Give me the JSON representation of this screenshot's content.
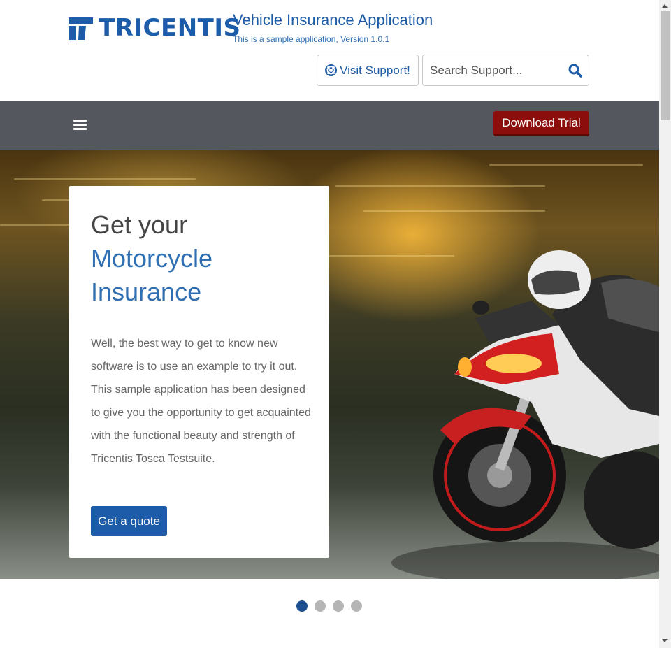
{
  "header": {
    "logo_text": "TRICENTIS",
    "app_title": "Vehicle Insurance Application",
    "app_subtitle": "This is a sample application, Version 1.0.1",
    "support_button": "Visit Support!",
    "search_placeholder": "Search Support..."
  },
  "navbar": {
    "download_trial": "Download Trial"
  },
  "hero": {
    "title_line1": "Get your",
    "title_line2": "Motorcycle",
    "title_line3": "Insurance",
    "body": "Well, the best way to get to know new software is to use an example to try it out. This sample application has been designed to give you the opportunity to get acquainted with the functional beauty and strength of Tricentis Tosca Testsuite.",
    "cta": "Get a quote"
  },
  "carousel": {
    "slides": 4,
    "active_index": 0
  },
  "colors": {
    "brand_blue": "#1c5ca8",
    "nav_gray": "#54585e",
    "trial_red": "#8b0d0c",
    "dot_active": "#1c4f8f",
    "dot_inactive": "#b5b5b5"
  },
  "icons": {
    "logo": "tricentis-logo-icon",
    "support": "lifebuoy-icon",
    "search": "search-icon",
    "menu": "hamburger-menu-icon"
  }
}
